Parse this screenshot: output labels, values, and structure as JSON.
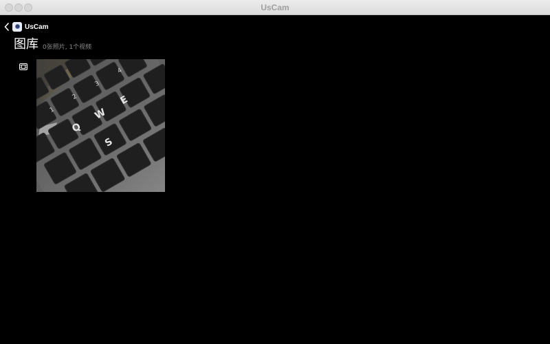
{
  "window": {
    "title": "UsCam"
  },
  "nav": {
    "back_icon": "chevron-left-icon",
    "app_icon": "uscam-app-icon",
    "app_name": "UsCam"
  },
  "gallery": {
    "title": "图库",
    "count_text": "0张照片, 1个视频",
    "filter_icon": "film-icon",
    "items": [
      {
        "kind": "video",
        "keys": [
          "1",
          "2",
          "3",
          "4",
          "Q",
          "W",
          "E",
          "S"
        ]
      }
    ]
  },
  "colors": {
    "background": "#000000",
    "titlebar": "#e0e0e0",
    "text_primary": "#ffffff",
    "text_secondary": "#8a8a8a"
  }
}
